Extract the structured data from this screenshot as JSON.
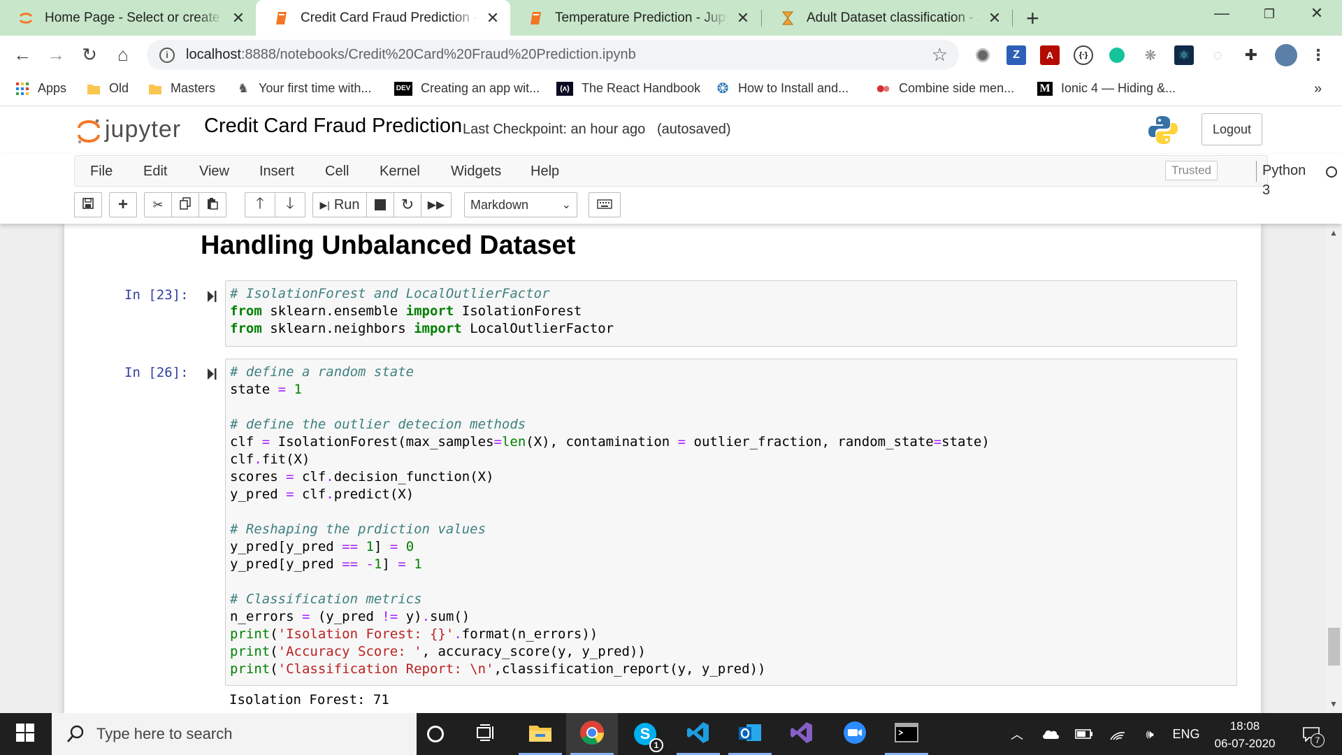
{
  "browser": {
    "tabs": [
      {
        "title": "Home Page - Select or create a notebook",
        "icon": "jupyter-icon"
      },
      {
        "title": "Credit Card Fraud Prediction - Jupyter Notebook",
        "icon": "notebook-icon",
        "active": true
      },
      {
        "title": "Temperature Prediction - Jupyter Notebook",
        "icon": "notebook-icon"
      },
      {
        "title": "Adult Dataset classification - Jupyter Notebook",
        "icon": "hourglass-icon"
      }
    ],
    "close_glyph": "✕",
    "new_tab_glyph": "+",
    "url_host": "localhost",
    "url_path": ":8888/notebooks/Credit%20Card%20Fraud%20Prediction.ipynb",
    "bookmarks": [
      {
        "label": "Apps",
        "icon": "apps-grid-icon"
      },
      {
        "label": "Old",
        "icon": "folder-icon"
      },
      {
        "label": "Masters",
        "icon": "folder-icon"
      },
      {
        "label": "Your first time with...",
        "icon": "figure-icon"
      },
      {
        "label": "Creating an app wit...",
        "icon": "dev-icon",
        "badge": "DEV"
      },
      {
        "label": "The React Handbook",
        "icon": "freecodecamp-icon"
      },
      {
        "label": "How to Install and...",
        "icon": "globe-icon"
      },
      {
        "label": "Combine side men...",
        "icon": "dots-icon"
      },
      {
        "label": "Ionic 4 — Hiding &...",
        "icon": "medium-icon",
        "badge": "M"
      }
    ],
    "bookmarks_overflow": "»"
  },
  "jupyter": {
    "logo_text": "jupyter",
    "notebook_title": "Credit Card Fraud Prediction",
    "checkpoint": "Last Checkpoint: an hour ago",
    "autosave": "(autosaved)",
    "logout_label": "Logout",
    "menus": [
      "File",
      "Edit",
      "View",
      "Insert",
      "Cell",
      "Kernel",
      "Widgets",
      "Help"
    ],
    "trusted_label": "Trusted",
    "kernel_name": "Python 3",
    "run_label": "Run",
    "cell_type": "Markdown"
  },
  "notebook": {
    "heading": "Handling Unbalanced Dataset",
    "cells": [
      {
        "prompt": "In [23]:",
        "lines": [
          [
            [
              "cm",
              "# IsolationForest and LocalOutlierFactor"
            ]
          ],
          [
            [
              "kw",
              "from"
            ],
            [
              "",
              " sklearn.ensemble "
            ],
            [
              "kw",
              "import"
            ],
            [
              "",
              " IsolationForest"
            ]
          ],
          [
            [
              "kw",
              "from"
            ],
            [
              "",
              " sklearn.neighbors "
            ],
            [
              "kw",
              "import"
            ],
            [
              "",
              " LocalOutlierFactor"
            ]
          ]
        ]
      },
      {
        "prompt": "In [26]:",
        "lines": [
          [
            [
              "cm",
              "# define a random state"
            ]
          ],
          [
            [
              "",
              "state "
            ],
            [
              "op",
              "="
            ],
            [
              "",
              " "
            ],
            [
              "num",
              "1"
            ]
          ],
          [],
          [
            [
              "cm",
              "# define the outlier detecion methods"
            ]
          ],
          [
            [
              "",
              "clf "
            ],
            [
              "op",
              "="
            ],
            [
              "",
              " IsolationForest(max_samples"
            ],
            [
              "op",
              "="
            ],
            [
              "bi",
              "len"
            ],
            [
              "",
              "(X), contamination "
            ],
            [
              "op",
              "="
            ],
            [
              "",
              " outlier_fraction, random_state"
            ],
            [
              "op",
              "="
            ],
            [
              "",
              "state)"
            ]
          ],
          [
            [
              "",
              "clf"
            ],
            [
              "op",
              "."
            ],
            [
              "",
              "fit(X)"
            ]
          ],
          [
            [
              "",
              "scores "
            ],
            [
              "op",
              "="
            ],
            [
              "",
              " clf"
            ],
            [
              "op",
              "."
            ],
            [
              "",
              "decision_function(X)"
            ]
          ],
          [
            [
              "",
              "y_pred "
            ],
            [
              "op",
              "="
            ],
            [
              "",
              " clf"
            ],
            [
              "op",
              "."
            ],
            [
              "",
              "predict(X)"
            ]
          ],
          [],
          [
            [
              "cm",
              "# Reshaping the prdiction values"
            ]
          ],
          [
            [
              "",
              "y_pred[y_pred "
            ],
            [
              "op",
              "=="
            ],
            [
              "",
              " "
            ],
            [
              "num",
              "1"
            ],
            [
              "",
              "] "
            ],
            [
              "op",
              "="
            ],
            [
              "",
              " "
            ],
            [
              "num",
              "0"
            ]
          ],
          [
            [
              "",
              "y_pred[y_pred "
            ],
            [
              "op",
              "=="
            ],
            [
              "",
              " "
            ],
            [
              "op",
              "-"
            ],
            [
              "num",
              "1"
            ],
            [
              "",
              "] "
            ],
            [
              "op",
              "="
            ],
            [
              "",
              " "
            ],
            [
              "num",
              "1"
            ]
          ],
          [],
          [
            [
              "cm",
              "# Classification metrics"
            ]
          ],
          [
            [
              "",
              "n_errors "
            ],
            [
              "op",
              "="
            ],
            [
              "",
              " (y_pred "
            ],
            [
              "op",
              "!="
            ],
            [
              "",
              " y)"
            ],
            [
              "op",
              "."
            ],
            [
              "",
              "sum()"
            ]
          ],
          [
            [
              "bi",
              "print"
            ],
            [
              "",
              "("
            ],
            [
              "str",
              "'Isolation Forest: {}'"
            ],
            [
              "op",
              "."
            ],
            [
              "",
              "format(n_errors))"
            ]
          ],
          [
            [
              "bi",
              "print"
            ],
            [
              "",
              "("
            ],
            [
              "str",
              "'Accuracy Score: '"
            ],
            [
              "",
              ", accuracy_score(y, y_pred))"
            ]
          ],
          [
            [
              "bi",
              "print"
            ],
            [
              "",
              "("
            ],
            [
              "str",
              "'Classification Report: \\n'"
            ],
            [
              "",
              ",classification_report(y, y_pred))"
            ]
          ]
        ]
      }
    ],
    "output": "Isolation Forest: 71"
  },
  "taskbar": {
    "search_placeholder": "Type here to search",
    "skype_badge": "1",
    "language": "ENG",
    "time": "18:08",
    "date": "06-07-2020",
    "notification_count": "7"
  },
  "colors": {
    "tabstrip": "#c8e6c9",
    "jupyter_orange": "#f37726",
    "prompt_blue": "#303f9f",
    "keyword_green": "#008000",
    "comment_teal": "#408080",
    "operator_purple": "#aa22ff",
    "string_red": "#ba2121"
  }
}
